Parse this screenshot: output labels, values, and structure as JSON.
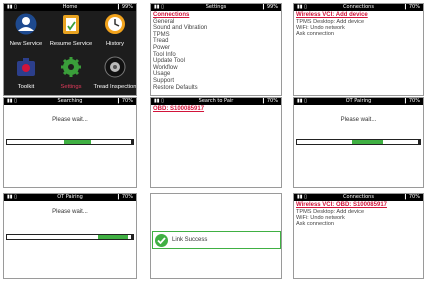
{
  "status": {
    "signal": "\u0007\b",
    "battery": "▎99%",
    "battery2": "▎70%"
  },
  "home": {
    "title": "Home",
    "items": [
      {
        "label": "New Service",
        "icon": "person-icon"
      },
      {
        "label": "Resume Service",
        "icon": "clipboard-icon"
      },
      {
        "label": "History",
        "icon": "clock-icon"
      },
      {
        "label": "Toolkit",
        "icon": "toolbox-icon"
      },
      {
        "label": "Settings",
        "icon": "gear-icon",
        "selected": true
      },
      {
        "label": "Tread Inspection",
        "icon": "tire-icon"
      }
    ]
  },
  "settings": {
    "title": "Settings",
    "items": [
      "Connections",
      "General",
      "Sound and Vibration",
      "TPMS",
      "Tread",
      "Power",
      "Tool Info",
      "Update Tool",
      "Workflow",
      "Usage",
      "Support",
      "Restore Defaults"
    ]
  },
  "connections": {
    "title": "Connections",
    "first": "Wireless VCI: Add device",
    "lines": [
      "TPMS Desktop: Add device",
      "WiFi: Undo network",
      "Ask connection"
    ]
  },
  "searching": {
    "title": "Searching",
    "message": "Please wait...",
    "progress": 0.35
  },
  "search_pair": {
    "title": "Search to Pair",
    "obd": "OBD: S100085917"
  },
  "ot_pairing_1": {
    "title": "OT Pairing",
    "message": "Please wait...",
    "progress": 0.45
  },
  "ot_pairing_2": {
    "title": "OT Pairing",
    "message": "Please wait...",
    "progress": 0.75
  },
  "success": {
    "text": "Link Success"
  },
  "connections_2": {
    "title": "Connections",
    "first": "Wireless VCI: OBD: S100085917",
    "lines": [
      "TPMS Desktop: Add device",
      "WiFi: Undo network",
      "Ask connection"
    ]
  },
  "colors": {
    "accent": "#d2143a",
    "progress": "#40b043",
    "statusbar": "#000000"
  }
}
